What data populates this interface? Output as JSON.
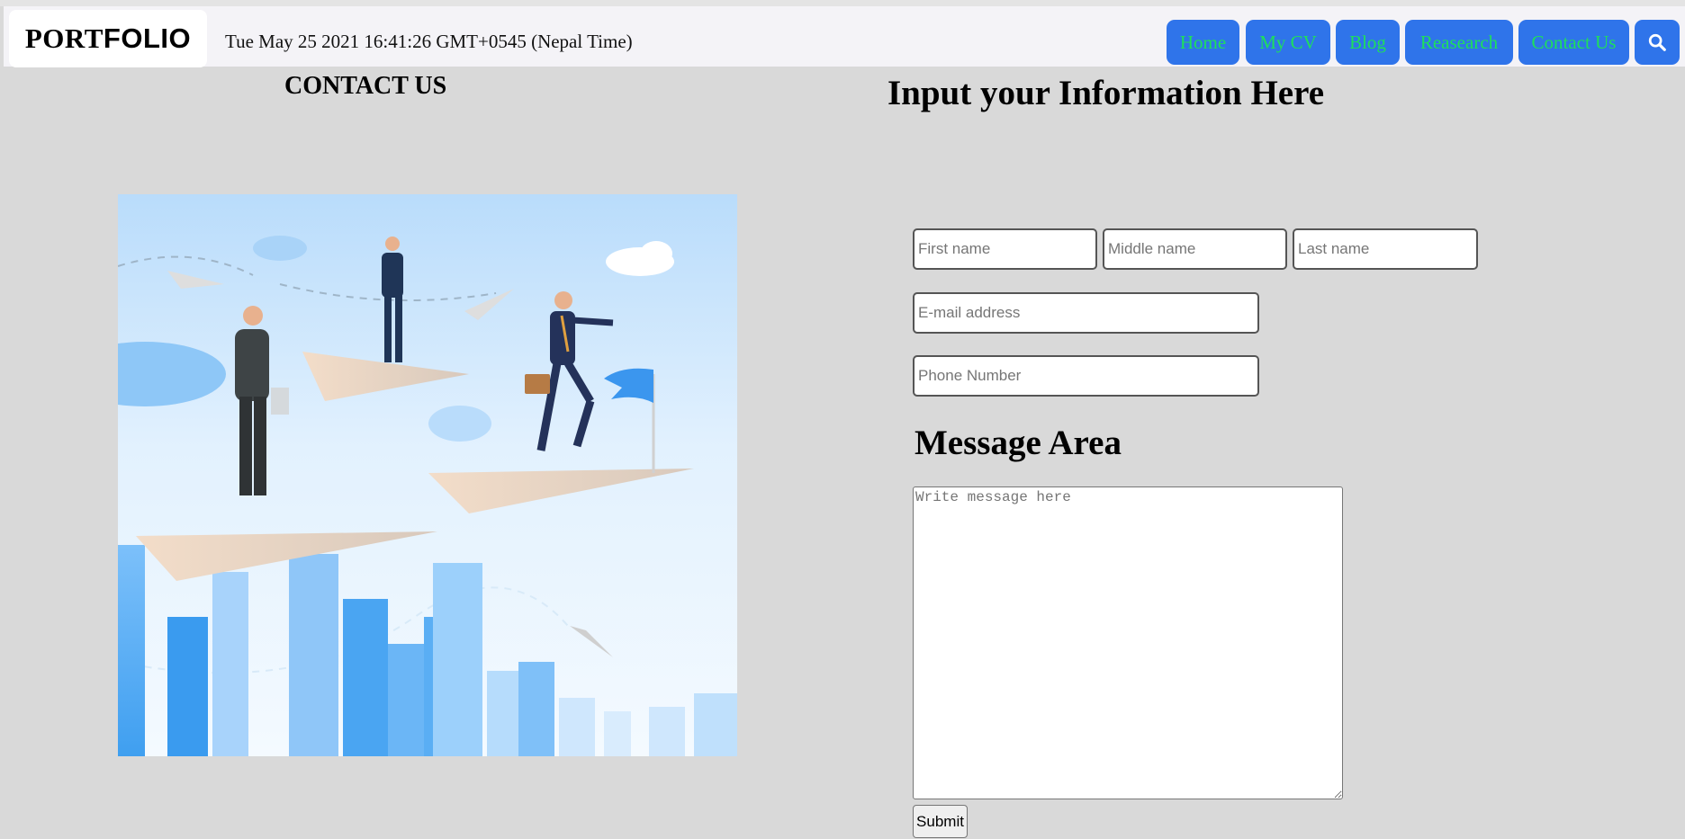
{
  "header": {
    "logo_part1": "PORT",
    "logo_part2": "FOLIO",
    "datetime": "Tue May 25 2021 16:41:26 GMT+0545 (Nepal Time)",
    "nav": [
      {
        "label": "Home"
      },
      {
        "label": "My CV"
      },
      {
        "label": "Blog"
      },
      {
        "label": "Reasearch"
      },
      {
        "label": "Contact Us"
      }
    ],
    "search_icon": "search-icon",
    "nav_bg_color": "#2f74ea",
    "nav_text_color": "#1ee05a"
  },
  "left": {
    "title": "CONTACT US",
    "illustration": "business-people-on-paper-planes-illustration"
  },
  "form": {
    "title": "Input your Information Here",
    "first_name_placeholder": "First name",
    "middle_name_placeholder": "Middle name",
    "last_name_placeholder": "Last name",
    "email_placeholder": "E-mail address",
    "phone_placeholder": "Phone Number",
    "message_title": "Message Area",
    "message_placeholder": "Write message here",
    "submit_label": "Submit"
  }
}
